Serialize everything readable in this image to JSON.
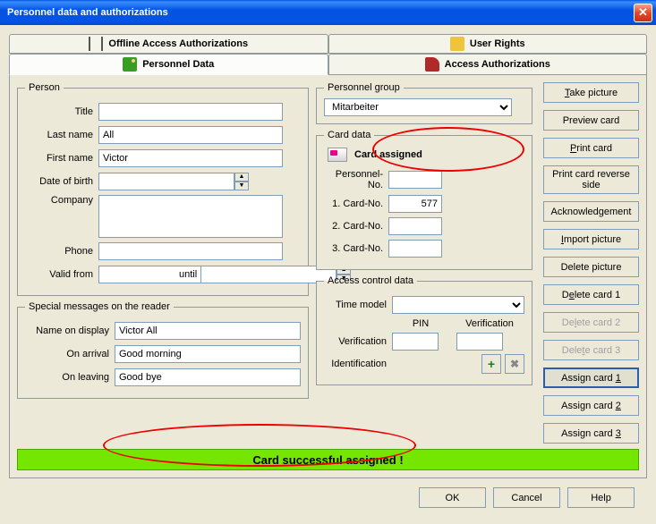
{
  "window": {
    "title": "Personnel data and authorizations"
  },
  "tabs": {
    "offline": "Offline Access Authorizations",
    "user_rights": "User Rights",
    "personnel": "Personnel Data",
    "access_auth": "Access Authorizations"
  },
  "person": {
    "legend": "Person",
    "title_label": "Title",
    "title": "",
    "lastname_label": "Last name",
    "lastname": "All",
    "firstname_label": "First name",
    "firstname": "Victor",
    "dob_label": "Date of birth",
    "dob": "",
    "company_label": "Company",
    "company": "",
    "phone_label": "Phone",
    "phone": "",
    "validfrom_label": "Valid from",
    "validfrom": "",
    "until_label": "until",
    "until": ""
  },
  "special": {
    "legend": "Special messages on the reader",
    "name_label": "Name on display",
    "name": "Victor All",
    "arrival_label": "On arrival",
    "arrival": "Good morning",
    "leaving_label": "On leaving",
    "leaving": "Good bye"
  },
  "pgroup": {
    "legend": "Personnel group",
    "value": "Mitarbeiter"
  },
  "card": {
    "legend": "Card data",
    "status": "Card assigned",
    "pno_label": "Personnel-No.",
    "pno": "",
    "c1_label": "1. Card-No.",
    "c1": "577",
    "c2_label": "2. Card-No.",
    "c2": "",
    "c3_label": "3. Card-No.",
    "c3": ""
  },
  "acd": {
    "legend": "Access control data",
    "timemodel_label": "Time model",
    "timemodel": "",
    "pin_header": "PIN",
    "ver_header": "Verification",
    "verification_label": "Verification",
    "ver_pin": "",
    "ver_ver": "",
    "ident_label": "Identification"
  },
  "sidebuttons": {
    "take_picture": "Take picture",
    "preview": "Preview card",
    "print": "Print card",
    "print_reverse": "Print card reverse side",
    "ack": "Acknowledgement",
    "import": "Import picture",
    "delete_pic": "Delete picture",
    "del1": "Delete card 1",
    "del2": "Delete card 2",
    "del3": "Delete card 3",
    "assign1": "Assign card 1",
    "assign2": "Assign card 2",
    "assign3": "Assign card 3"
  },
  "banner": "Card successful assigned !",
  "bottom": {
    "ok": "OK",
    "cancel": "Cancel",
    "help": "Help"
  }
}
